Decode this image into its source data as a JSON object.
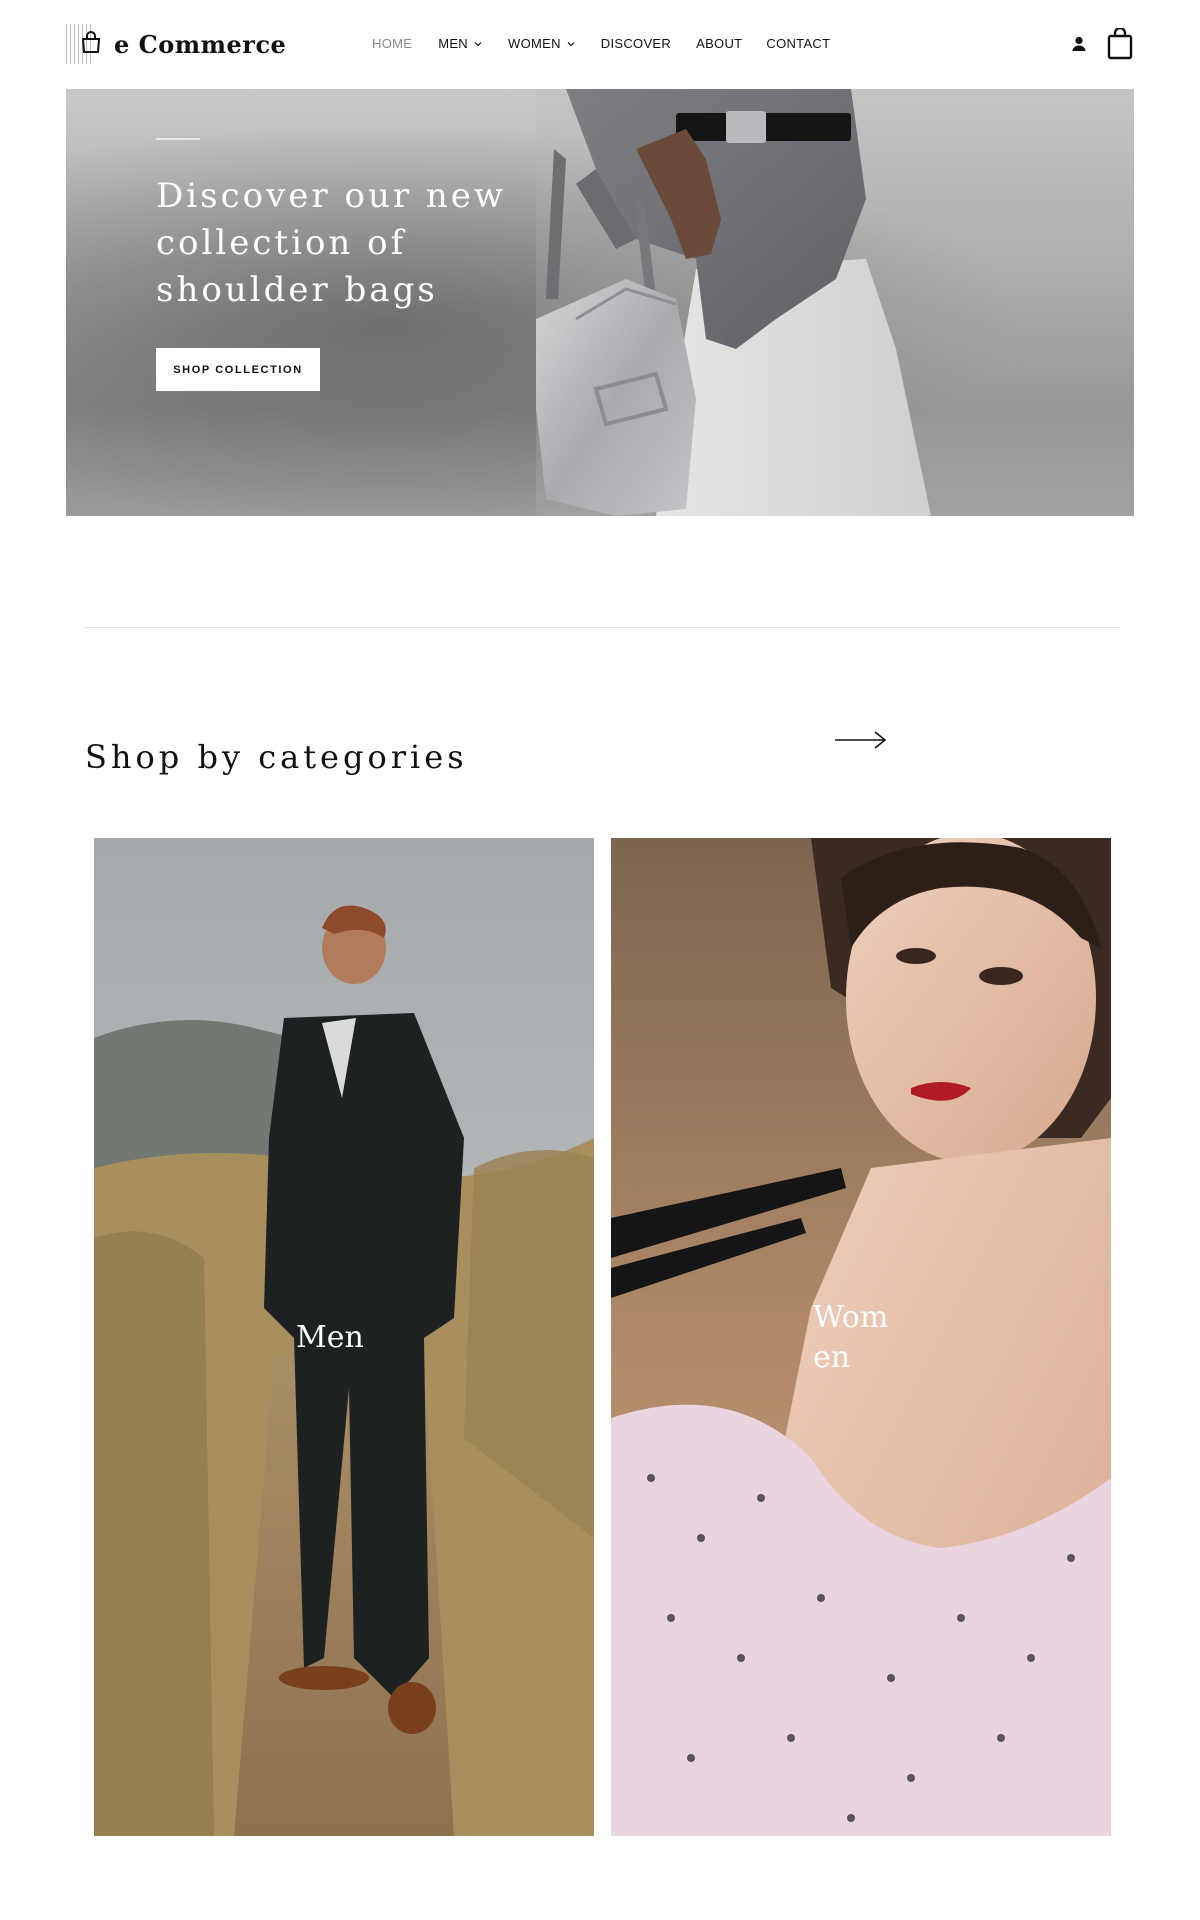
{
  "header": {
    "logo_text": "e Commerce",
    "nav": [
      {
        "label": "HOME",
        "active": true
      },
      {
        "label": "MEN",
        "dropdown": true
      },
      {
        "label": "WOMEN",
        "dropdown": true
      },
      {
        "label": "DISCOVER"
      },
      {
        "label": "ABOUT"
      },
      {
        "label": "CONTACT"
      }
    ],
    "icons": [
      "user-icon",
      "shopping-bag-icon"
    ]
  },
  "hero": {
    "title": "Discover our new collection of shoulder bags",
    "button_label": "SHOP COLLECTION"
  },
  "categories": {
    "title": "Shop by categories",
    "next_icon": "arrow-right-icon",
    "items": [
      {
        "label": "Men"
      },
      {
        "label": "Women"
      }
    ]
  },
  "colors": {
    "text": "#111111",
    "nav_active": "#8a8a8a",
    "hero_bg": "#a9a9a9",
    "button_bg": "#ffffff",
    "divider": "#e3e3e3"
  }
}
